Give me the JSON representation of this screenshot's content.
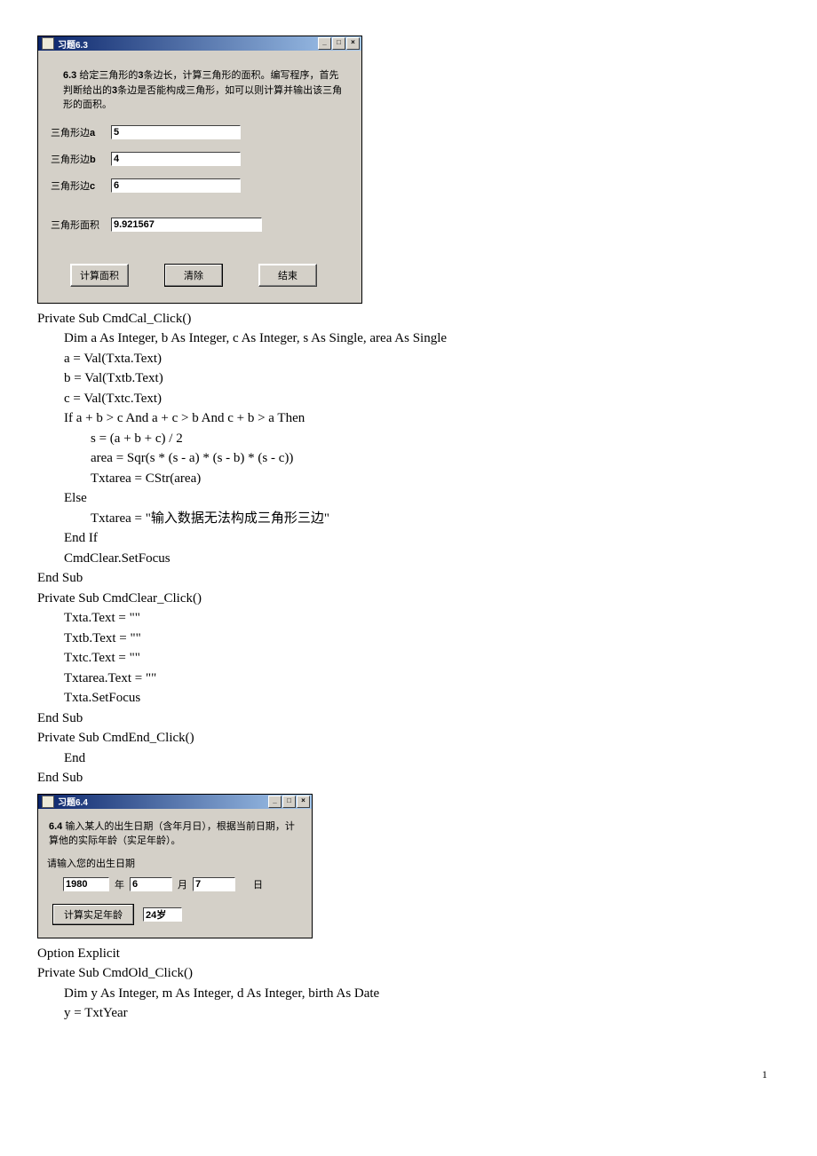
{
  "win63": {
    "title": "习题6.3",
    "description": {
      "num": "6.3",
      "text1": "给定三角形的",
      "bold3": "3",
      "text2": "条边长，计算三角形的面积。编写程序，首先判断给出的",
      "text3": "条边是否能构成三角形，如可以则计算并输出该三角形的面积。"
    },
    "labels": {
      "sideA_pre": "三角形边",
      "sideA_key": "a",
      "sideB_pre": "三角形边",
      "sideB_key": "b",
      "sideC_pre": "三角形边",
      "sideC_key": "c",
      "area": "三角形面积"
    },
    "inputs": {
      "a": "5",
      "b": "4",
      "c": "6",
      "area": "9.921567"
    },
    "buttons": {
      "calc": "计算面积",
      "clear": "清除",
      "end": "结束"
    }
  },
  "code1": [
    "Private Sub CmdCal_Click()",
    "    Dim a As Integer, b As Integer, c As Integer, s As Single, area As Single",
    "    a = Val(Txta.Text)",
    "    b = Val(Txtb.Text)",
    "    c = Val(Txtc.Text)",
    "    If a + b > c And a + c > b And c + b > a Then",
    "        s = (a + b + c) / 2",
    "        area = Sqr(s * (s - a) * (s - b) * (s - c))",
    "        Txtarea = CStr(area)",
    "    Else",
    "        Txtarea = \"输入数据无法构成三角形三边\"",
    "    End If",
    "    CmdClear.SetFocus",
    "End Sub",
    "Private Sub CmdClear_Click()",
    "    Txta.Text = \"\"",
    "    Txtb.Text = \"\"",
    "    Txtc.Text = \"\"",
    "    Txtarea.Text = \"\"",
    "    Txta.SetFocus",
    "End Sub",
    "Private Sub CmdEnd_Click()",
    "    End",
    "End Sub"
  ],
  "win64": {
    "title": "习题6.4",
    "description": {
      "num": "6.4",
      "text": "输入某人的出生日期（含年月日），根据当前日期，计算他的实际年龄（实足年龄）。"
    },
    "prompt": "请输入您的出生日期",
    "labels": {
      "year": "年",
      "month": "月",
      "day": "日"
    },
    "inputs": {
      "year": "1980",
      "month": "6",
      "day": "7",
      "age": "24岁"
    },
    "button": "计算实足年龄"
  },
  "code2": [
    "Option Explicit",
    "Private Sub CmdOld_Click()",
    "    Dim y As Integer, m As Integer, d As Integer, birth As Date",
    "    y = TxtYear"
  ],
  "pagenum": "1"
}
